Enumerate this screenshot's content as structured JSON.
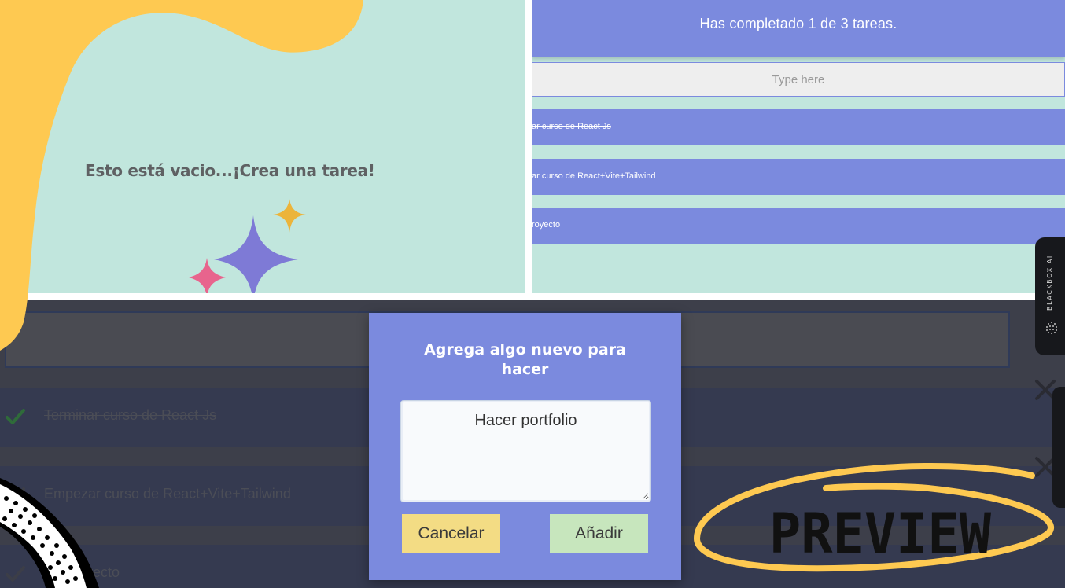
{
  "empty_panel": {
    "message": "Esto está vacio...¡Crea una tarea!"
  },
  "list_panel": {
    "counter_text": "Has completado 1 de 3 tareas.",
    "input_placeholder": "Type here",
    "items": [
      {
        "label": "ar curso de React Js",
        "completed": true
      },
      {
        "label": "ar curso de React+Vite+Tailwind",
        "completed": false
      },
      {
        "label": "royecto",
        "completed": false
      }
    ]
  },
  "dark_list": {
    "items": [
      {
        "label": "Terminar curso de React Js",
        "completed": true
      },
      {
        "label": "Empezar curso de React+Vite+Tailwind",
        "completed": false
      },
      {
        "label": "Su  proyecto",
        "completed": false
      }
    ]
  },
  "modal": {
    "title": "Agrega algo nuevo para hacer",
    "textarea_value": "Hacer portfolio",
    "cancel_label": "Cancelar",
    "add_label": "Añadir"
  },
  "side_widget": {
    "label": "BLACKBOX AI"
  },
  "overlay": {
    "preview_label": "PREVIEW"
  },
  "colors": {
    "accent_blue": "#7b8ade",
    "mint_background": "#c1e6dd",
    "blob_yellow": "#fec951",
    "cancel_yellow": "#f3dc84",
    "add_green": "#c7e6bd",
    "check_green": "#2f6b3a",
    "sparkle_purple": "#7e7ad6",
    "sparkle_pink": "#e8648d",
    "sparkle_gold": "#ecb43a"
  },
  "icons": [
    "sparkle-icon",
    "check-icon",
    "close-icon",
    "blackbox-dots-icon"
  ]
}
